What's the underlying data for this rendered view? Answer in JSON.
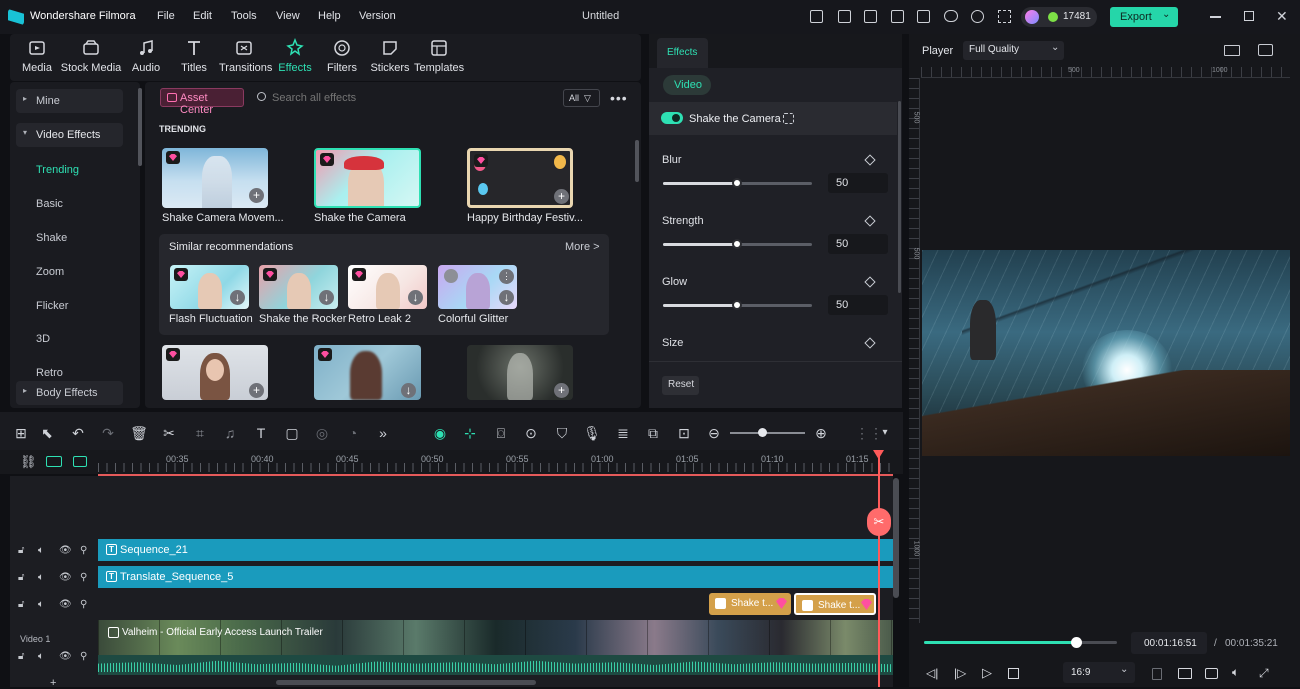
{
  "app": {
    "name": "Wondershare Filmora",
    "doc_title": "Untitled",
    "menu": [
      "File",
      "Edit",
      "Tools",
      "View",
      "Help",
      "Version"
    ],
    "credits": "17481",
    "export_label": "Export"
  },
  "toolbar": {
    "tabs": [
      {
        "label": "Media",
        "icon": "media-icon"
      },
      {
        "label": "Stock Media",
        "icon": "stock-media-icon"
      },
      {
        "label": "Audio",
        "icon": "audio-icon"
      },
      {
        "label": "Titles",
        "icon": "titles-icon"
      },
      {
        "label": "Transitions",
        "icon": "transitions-icon"
      },
      {
        "label": "Effects",
        "icon": "effects-icon",
        "active": true
      },
      {
        "label": "Filters",
        "icon": "filters-icon"
      },
      {
        "label": "Stickers",
        "icon": "stickers-icon"
      },
      {
        "label": "Templates",
        "icon": "templates-icon"
      }
    ]
  },
  "sidebar": {
    "mine": "Mine",
    "video_effects": "Video Effects",
    "items": [
      "Trending",
      "Basic",
      "Shake",
      "Zoom",
      "Flicker",
      "3D",
      "Retro"
    ],
    "body_effects": "Body Effects"
  },
  "browser": {
    "asset_center": "Asset Center",
    "search_placeholder": "Search all effects",
    "filter_label": "All",
    "section_title": "TRENDING",
    "trending": [
      "Shake Camera Movem...",
      "Shake the Camera",
      "Happy Birthday Festiv..."
    ],
    "similar_title": "Similar recommendations",
    "more_label": "More >",
    "similar": [
      "Flash Fluctuation",
      "Shake the Rocker",
      "Retro Leak 2",
      "Colorful Glitter"
    ]
  },
  "effects_panel": {
    "tab": "Effects",
    "subtab": "Video",
    "effect_name": "Shake the Camera",
    "params": [
      {
        "label": "Blur",
        "value": "50",
        "level": 0.5
      },
      {
        "label": "Strength",
        "value": "50",
        "level": 0.5
      },
      {
        "label": "Glow",
        "value": "50",
        "level": 0.5
      },
      {
        "label": "Size",
        "value": "",
        "level": 0.5
      }
    ],
    "reset_label": "Reset"
  },
  "player": {
    "label": "Player",
    "quality": "Full Quality",
    "ruler_h": [
      "500",
      "1000"
    ],
    "ruler_v": [
      "500",
      "500",
      "1000"
    ],
    "current_time": "00:01:16:51",
    "separator": "/",
    "total_time": "00:01:35:21",
    "progress": 0.79,
    "aspect": "16:9"
  },
  "timeline": {
    "ruler": [
      "00:35",
      "00:40",
      "00:45",
      "00:50",
      "00:55",
      "01:00",
      "01:05",
      "01:10",
      "01:15"
    ],
    "clips": {
      "seq21": "Sequence_21",
      "seq5": "Translate_Sequence_5",
      "fx1": "Shake t...",
      "fx2": "Shake t...",
      "video": "Valheim - Official Early Access Launch Trailer"
    },
    "video_track_label": "Video 1",
    "add_track": "+"
  }
}
